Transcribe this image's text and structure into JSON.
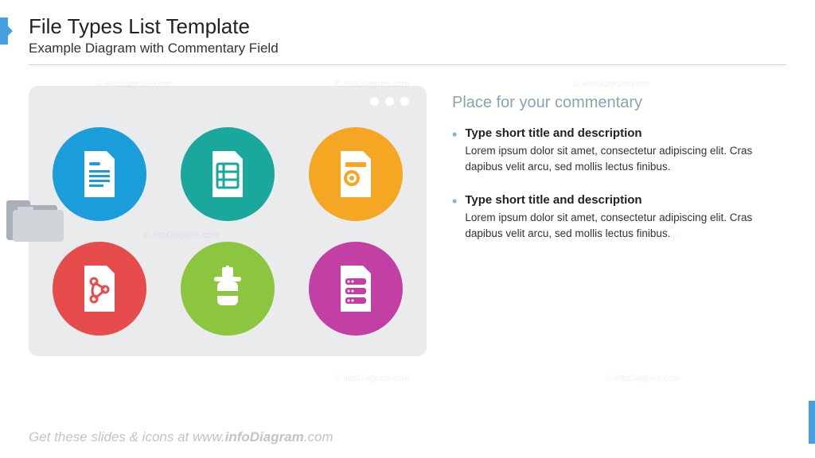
{
  "header": {
    "title": "File Types List Template",
    "subtitle": "Example Diagram with Commentary Field"
  },
  "panel": {
    "tiles": [
      {
        "name": "document-text-icon",
        "bg": "#1b9dd9"
      },
      {
        "name": "spreadsheet-icon",
        "bg": "#1aa89c"
      },
      {
        "name": "media-file-icon",
        "bg": "#f5a623"
      },
      {
        "name": "pdf-file-icon",
        "bg": "#e64c4c"
      },
      {
        "name": "archive-zip-icon",
        "bg": "#8cc63f"
      },
      {
        "name": "database-file-icon",
        "bg": "#c23fa3"
      }
    ]
  },
  "commentary": {
    "heading": "Place for your commentary",
    "items": [
      {
        "title": "Type short title and description",
        "body": "Lorem ipsum dolor sit amet, consectetur adipiscing elit. Cras dapibus velit arcu, sed mollis lectus finibus."
      },
      {
        "title": "Type short title and description",
        "body": "Lorem ipsum dolor sit amet, consectetur adipiscing elit. Cras dapibus velit arcu, sed mollis lectus finibus."
      }
    ]
  },
  "footer": {
    "prefix": "Get these slides & icons at www.",
    "brand": "infoDiagram",
    "suffix": ".com"
  },
  "watermark": "© infoDiagram.com"
}
